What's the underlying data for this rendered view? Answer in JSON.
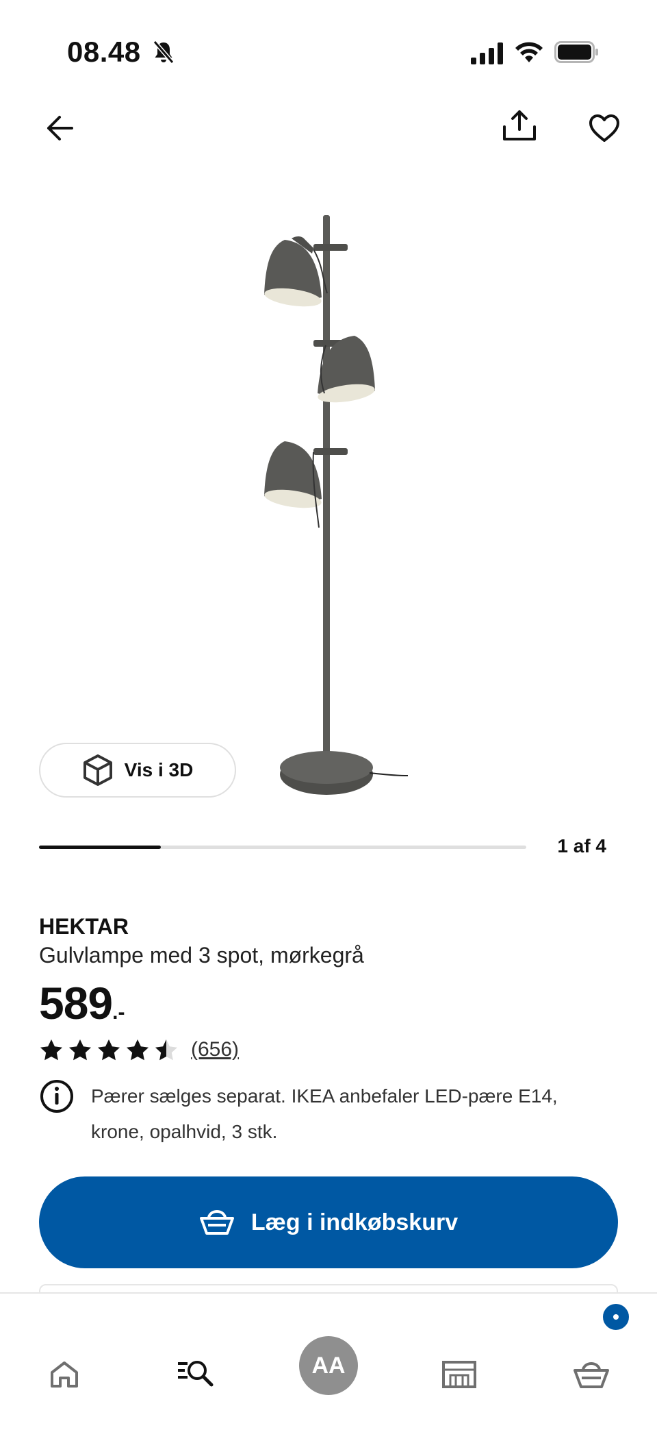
{
  "status_bar": {
    "time": "08.48",
    "icons": [
      "bell-slash-icon",
      "signal-icon",
      "wifi-icon",
      "battery-icon"
    ]
  },
  "top_bar": {
    "icons": [
      "arrow-left-icon",
      "share-icon",
      "heart-icon"
    ]
  },
  "product": {
    "view_3d_label": "Vis i 3D",
    "carousel": {
      "counter": "1 af 4",
      "current": 1,
      "total": 4
    },
    "name": "HEKTAR",
    "description": "Gulvlampe med 3 spot, mørkegrå",
    "price": "589",
    "price_suffix": ".-",
    "rating": {
      "stars": 4.5,
      "max": 5,
      "count_label": "(656)"
    },
    "info_note": "Pærer sælges separat. IKEA anbefaler LED-pære E14, krone, opalhvid, 3 stk.",
    "add_to_cart_label": "Læg i indkøbskurv"
  },
  "bottom_nav": {
    "items": [
      "home-icon",
      "search-icon",
      "avatar",
      "store-icon",
      "cart-icon"
    ],
    "avatar_initials": "AA"
  },
  "colors": {
    "accent_blue": "#0058a3",
    "text_primary": "#111111",
    "lamp_gray": "#5a5a57",
    "avatar_gray": "#8f8f8f"
  }
}
